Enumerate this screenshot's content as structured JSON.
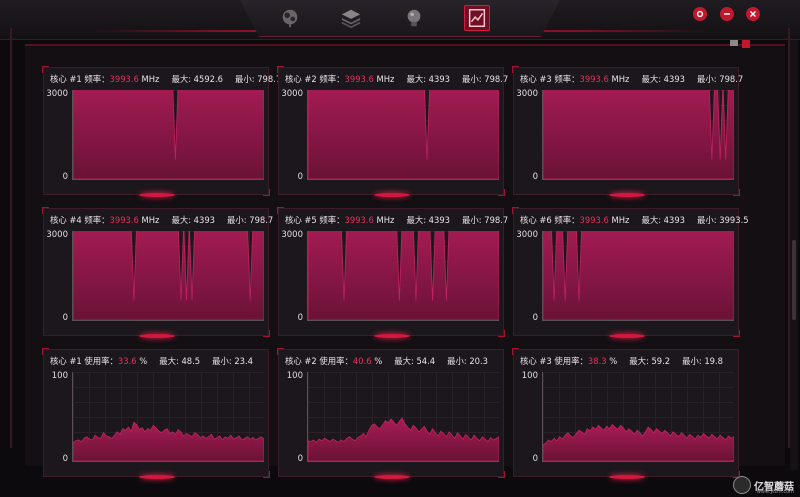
{
  "nav": [
    {
      "name": "nav-light-icon",
      "active": false
    },
    {
      "name": "nav-layers-icon",
      "active": false
    },
    {
      "name": "nav-bulb-icon",
      "active": false
    },
    {
      "name": "nav-monitor-icon",
      "active": true
    }
  ],
  "window_buttons": [
    "settings-icon",
    "minimize-icon",
    "close-icon"
  ],
  "colors": {
    "accent": "#c81a45",
    "fill": "#9a1a4e",
    "bg": "#0c0a0d"
  },
  "panels": [
    {
      "label": "核心 #1 频率：",
      "value": "3993.6",
      "unit": "MHz",
      "max_label": "最大: 4592.6",
      "min_label": "最小: 798.7",
      "ymax": "3000",
      "ymin": "0",
      "kind": "freq",
      "chart": {
        "type": "area",
        "ylim": [
          0,
          3660
        ],
        "values": [
          3993.6,
          3993.6,
          3993.6,
          3993.6,
          3993.6,
          3993.6,
          3993.6,
          3993.6,
          3993.6,
          3993.6,
          3993.6,
          3993.6,
          3993.6,
          3993.6,
          3993.6,
          3993.6,
          3993.6,
          3993.6,
          3993.6,
          3993.6,
          3993.6,
          3993.6,
          3993.6,
          3993.6,
          3993.6,
          3993.6,
          3993.6,
          3993.6,
          3993.6,
          3993.6,
          3993.6,
          3993.6,
          3993.6,
          3993.6,
          3993.6,
          3993.6,
          3993.6,
          798.7,
          3993.6,
          3993.6,
          3993.6,
          3993.6,
          3993.6,
          3993.6,
          3993.6,
          3993.6,
          3993.6,
          3993.6,
          3993.6,
          3993.6,
          3993.6,
          3993.6,
          3993.6,
          3993.6,
          3993.6,
          3993.6,
          3993.6,
          3993.6,
          3993.6,
          3993.6,
          3993.6,
          3993.6,
          3993.6,
          3993.6,
          3993.6,
          3993.6,
          3993.6,
          3993.6,
          3993.6,
          3993.6
        ]
      }
    },
    {
      "label": "核心 #2 频率：",
      "value": "3993.6",
      "unit": "MHz",
      "max_label": "最大: 4393",
      "min_label": "最小: 798.7",
      "ymax": "3000",
      "ymin": "0",
      "kind": "freq",
      "chart": {
        "type": "area",
        "ylim": [
          0,
          3660
        ],
        "values": [
          3993.6,
          3993.6,
          3993.6,
          3993.6,
          3993.6,
          3993.6,
          3993.6,
          3993.6,
          3993.6,
          3993.6,
          3993.6,
          3993.6,
          3993.6,
          3993.6,
          3993.6,
          3993.6,
          3993.6,
          3993.6,
          3993.6,
          3993.6,
          3993.6,
          3993.6,
          3993.6,
          3993.6,
          3993.6,
          3993.6,
          3993.6,
          3993.6,
          3993.6,
          3993.6,
          3993.6,
          3993.6,
          3993.6,
          3993.6,
          3993.6,
          3993.6,
          3993.6,
          3993.6,
          3993.6,
          3993.6,
          3993.6,
          3993.6,
          3993.6,
          798.7,
          3993.6,
          3993.6,
          3993.6,
          3993.6,
          3993.6,
          3993.6,
          3993.6,
          3993.6,
          3993.6,
          3993.6,
          3993.6,
          3993.6,
          3993.6,
          3993.6,
          3993.6,
          3993.6,
          3993.6,
          3993.6,
          3993.6,
          3993.6,
          3993.6,
          3993.6,
          3993.6,
          3993.6,
          3993.6,
          3993.6
        ]
      }
    },
    {
      "label": "核心 #3 频率：",
      "value": "3993.6",
      "unit": "MHz",
      "max_label": "最大: 4393",
      "min_label": "最小: 798.7",
      "ymax": "3000",
      "ymin": "0",
      "kind": "freq",
      "chart": {
        "type": "area",
        "ylim": [
          0,
          3660
        ],
        "values": [
          3993.6,
          3993.6,
          3993.6,
          3993.6,
          3993.6,
          3993.6,
          3993.6,
          3993.6,
          3993.6,
          3993.6,
          3993.6,
          3993.6,
          3993.6,
          3993.6,
          3993.6,
          3993.6,
          3993.6,
          3993.6,
          3993.6,
          3993.6,
          3993.6,
          3993.6,
          3993.6,
          3993.6,
          3993.6,
          3993.6,
          3993.6,
          3993.6,
          3993.6,
          3993.6,
          3993.6,
          3993.6,
          3993.6,
          3993.6,
          3993.6,
          3993.6,
          3993.6,
          3993.6,
          3993.6,
          3993.6,
          3993.6,
          3993.6,
          3993.6,
          3993.6,
          3993.6,
          3993.6,
          3993.6,
          3993.6,
          3993.6,
          3993.6,
          3993.6,
          3993.6,
          3993.6,
          3993.6,
          3993.6,
          3993.6,
          3993.6,
          3993.6,
          3993.6,
          3993.6,
          3993.6,
          798.7,
          3993.6,
          3993.6,
          798.7,
          3993.6,
          798.7,
          3993.6,
          3993.6,
          3993.6
        ]
      }
    },
    {
      "label": "核心 #4 频率：",
      "value": "3993.6",
      "unit": "MHz",
      "max_label": "最大: 4393",
      "min_label": "最小: 798.7",
      "ymax": "3000",
      "ymin": "0",
      "kind": "freq",
      "chart": {
        "type": "area",
        "ylim": [
          0,
          3660
        ],
        "values": [
          3993.6,
          3993.6,
          3993.6,
          3993.6,
          3993.6,
          3993.6,
          3993.6,
          3993.6,
          3993.6,
          3993.6,
          3993.6,
          3993.6,
          3993.6,
          3993.6,
          3993.6,
          3993.6,
          3993.6,
          3993.6,
          3993.6,
          3993.6,
          3993.6,
          3993.6,
          798.7,
          3993.6,
          3993.6,
          3993.6,
          3993.6,
          3993.6,
          3993.6,
          3993.6,
          3993.6,
          3993.6,
          3993.6,
          3993.6,
          3993.6,
          3993.6,
          3993.6,
          3993.6,
          3993.6,
          798.7,
          3993.6,
          798.7,
          3993.6,
          798.7,
          3993.6,
          3993.6,
          3993.6,
          3993.6,
          3993.6,
          3993.6,
          3993.6,
          3993.6,
          3993.6,
          3993.6,
          3993.6,
          3993.6,
          3993.6,
          3993.6,
          3993.6,
          3993.6,
          3993.6,
          3993.6,
          3993.6,
          3993.6,
          798.7,
          3993.6,
          3993.6,
          3993.6,
          3993.6,
          3993.6
        ]
      }
    },
    {
      "label": "核心 #5 频率：",
      "value": "3993.6",
      "unit": "MHz",
      "max_label": "最大: 4393",
      "min_label": "最小: 798.7",
      "ymax": "3000",
      "ymin": "0",
      "kind": "freq",
      "chart": {
        "type": "area",
        "ylim": [
          0,
          3660
        ],
        "values": [
          3993.6,
          3993.6,
          3993.6,
          3993.6,
          3993.6,
          3993.6,
          3993.6,
          3993.6,
          3993.6,
          3993.6,
          3993.6,
          3993.6,
          3993.6,
          798.7,
          3993.6,
          3993.6,
          3993.6,
          3993.6,
          3993.6,
          3993.6,
          3993.6,
          3993.6,
          3993.6,
          3993.6,
          3993.6,
          3993.6,
          3993.6,
          3993.6,
          3993.6,
          3993.6,
          3993.6,
          3993.6,
          3993.6,
          798.7,
          3993.6,
          3993.6,
          3993.6,
          3993.6,
          3993.6,
          798.7,
          3993.6,
          3993.6,
          3993.6,
          3993.6,
          3993.6,
          798.7,
          3993.6,
          3993.6,
          3993.6,
          3993.6,
          798.7,
          3993.6,
          3993.6,
          3993.6,
          3993.6,
          3993.6,
          3993.6,
          3993.6,
          3993.6,
          3993.6,
          3993.6,
          3993.6,
          3993.6,
          3993.6,
          3993.6,
          3993.6,
          3993.6,
          3993.6,
          3993.6,
          3993.6
        ]
      }
    },
    {
      "label": "核心 #6 频率：",
      "value": "3993.6",
      "unit": "MHz",
      "max_label": "最大: 4393",
      "min_label": "最小: 3993.5",
      "ymax": "3000",
      "ymin": "0",
      "kind": "freq",
      "chart": {
        "type": "area",
        "ylim": [
          0,
          3660
        ],
        "values": [
          3993.6,
          3993.6,
          3993.6,
          3993.6,
          798.7,
          3993.6,
          3993.6,
          3993.6,
          798.7,
          3993.6,
          3993.6,
          3993.6,
          3993.6,
          798.7,
          3993.6,
          3993.6,
          3993.6,
          3993.6,
          3993.6,
          3993.6,
          3993.6,
          3993.6,
          3993.6,
          3993.6,
          3993.6,
          3993.6,
          3993.6,
          3993.6,
          3993.6,
          3993.6,
          3993.6,
          3993.6,
          3993.6,
          3993.6,
          3993.6,
          3993.6,
          3993.6,
          3993.6,
          3993.6,
          3993.6,
          3993.6,
          3993.6,
          3993.6,
          3993.6,
          3993.6,
          3993.6,
          3993.6,
          3993.6,
          3993.6,
          3993.6,
          3993.6,
          3993.6,
          3993.6,
          3993.6,
          3993.6,
          3993.6,
          3993.6,
          3993.6,
          3993.6,
          3993.6,
          3993.6,
          3993.6,
          3993.6,
          3993.6,
          3993.6,
          3993.6,
          3993.6,
          3993.6,
          3993.6,
          3993.6
        ]
      }
    },
    {
      "label": "核心 #1 使用率：",
      "value": "33.6",
      "unit": "%",
      "max_label": "最大: 48.5",
      "min_label": "最小: 23.4",
      "ymax": "100",
      "ymin": "0",
      "kind": "usage",
      "chart": {
        "type": "area",
        "ylim": [
          0,
          110
        ],
        "values": [
          22,
          25,
          26,
          24,
          28,
          30,
          27,
          26,
          32,
          29,
          28,
          35,
          31,
          30,
          28,
          32,
          36,
          33,
          40,
          38,
          42,
          37,
          48,
          45,
          39,
          41,
          36,
          40,
          38,
          44,
          41,
          37,
          35,
          38,
          40,
          34,
          36,
          33,
          39,
          36,
          31,
          34,
          32,
          30,
          35,
          33,
          29,
          31,
          28,
          30,
          33,
          27,
          29,
          31,
          26,
          30,
          28,
          32,
          27,
          29,
          31,
          26,
          28,
          30,
          27,
          29,
          26,
          28,
          30,
          27
        ]
      }
    },
    {
      "label": "核心 #2 使用率：",
      "value": "40.6",
      "unit": "%",
      "max_label": "最大: 54.4",
      "min_label": "最小: 20.3",
      "ymax": "100",
      "ymin": "0",
      "kind": "usage",
      "chart": {
        "type": "area",
        "ylim": [
          0,
          110
        ],
        "values": [
          25,
          24,
          26,
          23,
          27,
          25,
          28,
          26,
          24,
          27,
          25,
          23,
          26,
          24,
          28,
          30,
          27,
          25,
          29,
          31,
          34,
          30,
          38,
          44,
          46,
          42,
          40,
          45,
          50,
          47,
          52,
          48,
          44,
          49,
          53,
          46,
          42,
          38,
          44,
          41,
          36,
          39,
          43,
          37,
          33,
          40,
          35,
          31,
          37,
          34,
          30,
          36,
          32,
          28,
          35,
          31,
          27,
          33,
          29,
          26,
          32,
          28,
          25,
          30,
          27,
          24,
          29,
          26,
          28,
          30
        ]
      }
    },
    {
      "label": "核心 #3 使用率：",
      "value": "38.3",
      "unit": "%",
      "max_label": "最大: 59.2",
      "min_label": "最小: 19.8",
      "ymax": "100",
      "ymin": "0",
      "kind": "usage",
      "chart": {
        "type": "area",
        "ylim": [
          0,
          110
        ],
        "values": [
          20,
          22,
          26,
          24,
          28,
          25,
          30,
          27,
          32,
          35,
          31,
          29,
          34,
          38,
          36,
          33,
          40,
          37,
          42,
          39,
          44,
          41,
          38,
          43,
          40,
          45,
          42,
          39,
          44,
          41,
          36,
          40,
          37,
          33,
          38,
          35,
          31,
          36,
          42,
          39,
          35,
          40,
          37,
          34,
          38,
          35,
          31,
          36,
          33,
          30,
          35,
          32,
          28,
          33,
          30,
          27,
          32,
          29,
          34,
          31,
          28,
          33,
          30,
          27,
          32,
          29,
          26,
          31,
          28,
          30
        ]
      }
    }
  ],
  "watermark": {
    "text": "亿智蘑菇",
    "url": "www.yizhi.com"
  }
}
